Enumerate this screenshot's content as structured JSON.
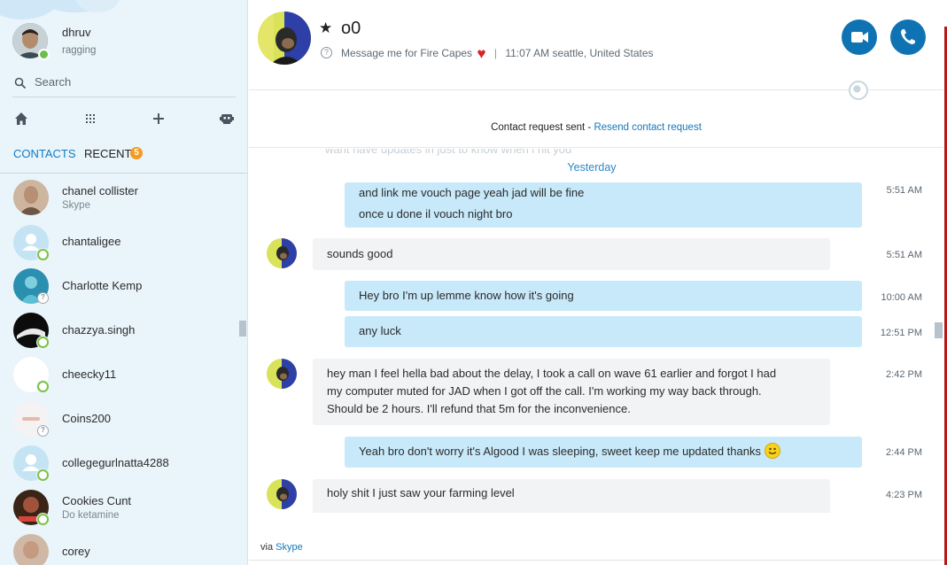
{
  "profile": {
    "name": "dhruv",
    "mood": "ragging"
  },
  "search": {
    "label": "Search"
  },
  "tabs": {
    "contacts": "CONTACTS",
    "recent": "RECENT",
    "recent_badge": "5"
  },
  "contacts": [
    {
      "name": "chanel collister",
      "sub": "Skype"
    },
    {
      "name": "chantaligee",
      "sub": ""
    },
    {
      "name": "Charlotte Kemp",
      "sub": ""
    },
    {
      "name": "chazzya.singh",
      "sub": ""
    },
    {
      "name": "cheecky11",
      "sub": ""
    },
    {
      "name": "Coins200",
      "sub": ""
    },
    {
      "name": "collegegurlnatta4288",
      "sub": ""
    },
    {
      "name": "Cookies Cunt",
      "sub": "Do ketamine"
    },
    {
      "name": "corey",
      "sub": ""
    }
  ],
  "chat": {
    "name": "o0",
    "mood": "Message me for Fire Capes",
    "location": "11:07 AM seattle, United States",
    "request_text": "Contact request sent - ",
    "request_link": "Resend contact request",
    "date_separator": "Yesterday",
    "faded_text": "want have updates in just to know when i hit you"
  },
  "messages": [
    {
      "lines": [
        "and link me vouch page yeah jad will be fine",
        "once u done il vouch night bro"
      ],
      "time": "5:51 AM"
    },
    {
      "lines": [
        "sounds good"
      ],
      "time": "5:51 AM"
    },
    {
      "lines": [
        "Hey bro I'm up lemme know how it's going"
      ],
      "time": "10:00 AM"
    },
    {
      "lines": [
        "any luck"
      ],
      "time": "12:51 PM"
    },
    {
      "lines": [
        "hey man I feel hella bad about the delay, I took a call on wave 61 earlier and forgot I had",
        "my computer muted for JAD when I got off the call. I'm working my way back through.",
        "Should be 2 hours. I'll refund that 5m for the inconvenience."
      ],
      "time": "2:42 PM"
    },
    {
      "lines": [
        "Yeah bro don't worry it's Algood I was sleeping, sweet keep me updated thanks"
      ],
      "time": "2:44 PM"
    },
    {
      "lines": [
        "holy shit I just saw your farming level"
      ],
      "time": "4:23 PM"
    }
  ],
  "footer": {
    "via": "via ",
    "skype": "Skype"
  },
  "colors": {
    "accent": "#0f73b3",
    "link": "#1478b8",
    "out_bubble": "#c7e9fa",
    "in_bubble": "#f1f3f5",
    "badge": "#f39c22"
  }
}
